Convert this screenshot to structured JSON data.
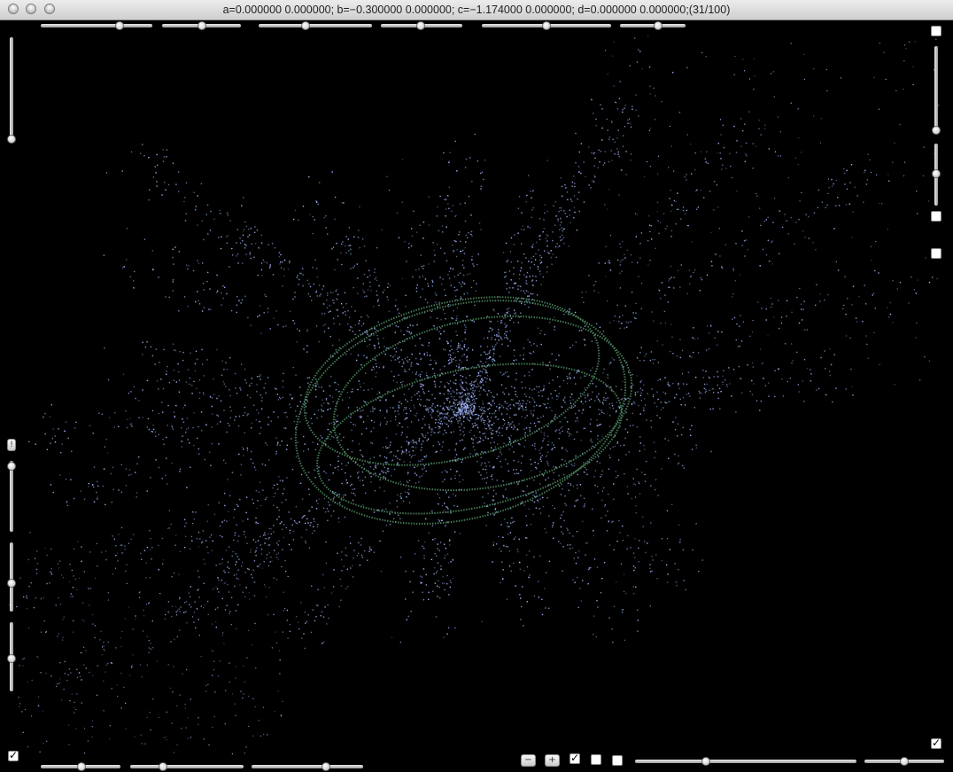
{
  "window": {
    "title": "a=0.000000 0.000000; b=−0.300000 0.000000; c=−1.174000 0.000000; d=0.000000 0.000000;(31/100)"
  },
  "controls": {
    "zoom_out_label": "−",
    "zoom_in_label": "+",
    "checkboxes": {
      "bottom_checkbox_1": true,
      "bottom_checkbox_2": false,
      "bottom_checkbox_3": false,
      "right_checkbox_top": false,
      "right_checkbox_mid": false,
      "right_checkbox_lower": false,
      "right_checkbox_bottom": true,
      "left_checkbox_bottom": true
    },
    "check_glyph": "✓",
    "left_button_label": "!"
  },
  "colors": {
    "background": "#000000",
    "fractal_blue": "#a9b6ff",
    "fractal_green": "#4f8f62",
    "titlebar_top": "#ececec",
    "titlebar_bottom": "#cfcfcf"
  }
}
